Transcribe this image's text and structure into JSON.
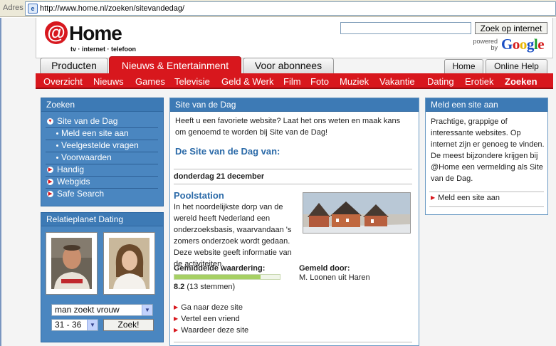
{
  "browser": {
    "address_label": "Adres",
    "url": "http://www.home.nl/zoeken/sitevandedag/"
  },
  "header": {
    "logo_at": "@",
    "logo_word": "Home",
    "logo_tagline": "tv · internet · telefoon",
    "search_button": "Zoek op internet",
    "search_value": "",
    "powered_by": "powered by",
    "google_letters": [
      "G",
      "o",
      "o",
      "g",
      "l",
      "e"
    ],
    "google_colors": [
      "#1a4fc4",
      "#d51b1b",
      "#e8b600",
      "#1a4fc4",
      "#1c9d2c",
      "#d51b1b"
    ]
  },
  "primary_tabs": {
    "producten": "Producten",
    "nieuws": "Nieuws & Entertainment",
    "abonnees": "Voor abonnees"
  },
  "utility_tabs": {
    "home": "Home",
    "help": "Online Help"
  },
  "nav": {
    "overzicht": "Overzicht",
    "nieuws": "Nieuws",
    "games": "Games",
    "televisie": "Televisie",
    "geld": "Geld & Werk",
    "film": "Film",
    "foto": "Foto",
    "muziek": "Muziek",
    "vakantie": "Vakantie",
    "dating": "Dating",
    "erotiek": "Erotiek",
    "zoeken": "Zoeken"
  },
  "sidebar": {
    "title": "Zoeken",
    "site_van_de_dag": "Site van de Dag",
    "meld": "Meld een site aan",
    "faq": "Veelgestelde vragen",
    "voorwaarden": "Voorwaarden",
    "handig": "Handig",
    "webgids": "Webgids",
    "safe_search": "Safe Search"
  },
  "dating": {
    "title": "Relatieplanet Dating",
    "seeking_select": "man zoekt vrouw",
    "age_select": "31 - 36",
    "button": "Zoek!"
  },
  "main": {
    "title": "Site van de Dag",
    "intro": "Heeft u een favoriete website? Laat het ons weten en maak kans om genoemd te worden bij Site van de Dag!",
    "heading": "De Site van de Dag van:",
    "date": "donderdag 21 december",
    "site_name": "Poolstation",
    "description": "In het noordelijkste dorp van de wereld heeft Nederland een onderzoeksbasis, waarvandaan 's zomers onderzoek wordt gedaan. Deze website geeft informatie van de activiteiten.",
    "rating_label": "Gemiddelde waardering:",
    "rating_value": "8.2",
    "rating_votes": "(13 stemmen)",
    "rating_fraction": 0.82,
    "reported_label": "Gemeld door:",
    "reported_by": "M. Loonen uit Haren",
    "link_goto": "Ga naar deze site",
    "link_tell": "Vertel een vriend",
    "link_rate": "Waardeer deze site"
  },
  "right": {
    "title": "Meld een site aan",
    "text": "Prachtige, grappige of interessante websites. Op internet zijn er genoeg te vinden. De meest bijzondere krijgen bij @Home een vermelding als Site van de Dag.",
    "link": "Meld een site aan"
  }
}
